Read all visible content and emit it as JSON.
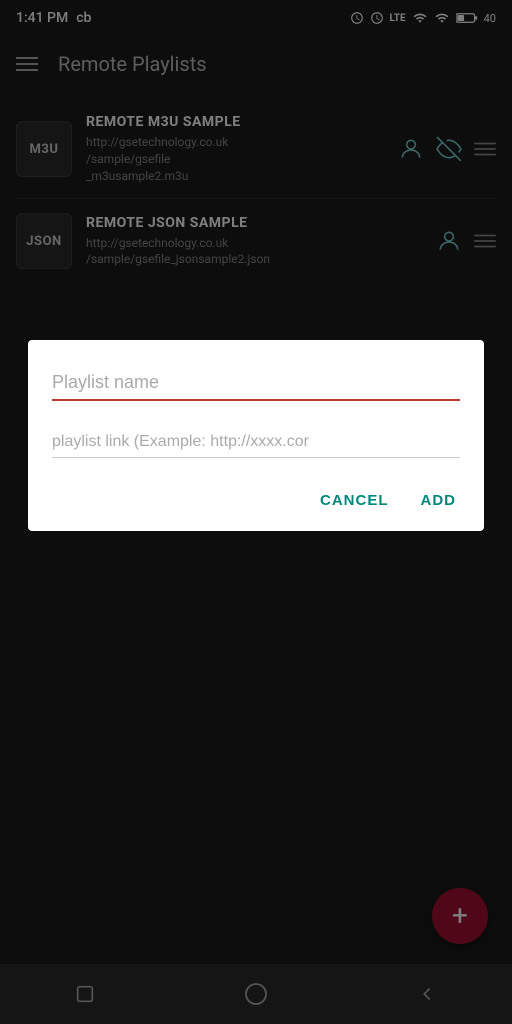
{
  "statusBar": {
    "time": "1:41 PM",
    "carrier": "cb",
    "battery": "40"
  },
  "appBar": {
    "title": "Remote Playlists"
  },
  "playlists": [
    {
      "id": 1,
      "badge": "M3U",
      "name": "REMOTE M3U SAMPLE",
      "url": "http://gsetechnology.co.uk/sample/gsefile_m3usample2.m3u",
      "hasEye": true
    },
    {
      "id": 2,
      "badge": "JSON",
      "name": "REMOTE JSON SAMPLE",
      "url": "http://gsetechnology.co.uk/sample/gsefile_jsonsample2.json",
      "hasEye": false
    }
  ],
  "dialog": {
    "namePlaceholder": "Playlist name",
    "linkPlaceholder": "playlist link (Example: http://xxxx.cor",
    "cancelLabel": "CANCEL",
    "addLabel": "ADD"
  },
  "fab": {
    "label": "+"
  },
  "navBar": {
    "items": [
      "square",
      "circle",
      "back"
    ]
  }
}
